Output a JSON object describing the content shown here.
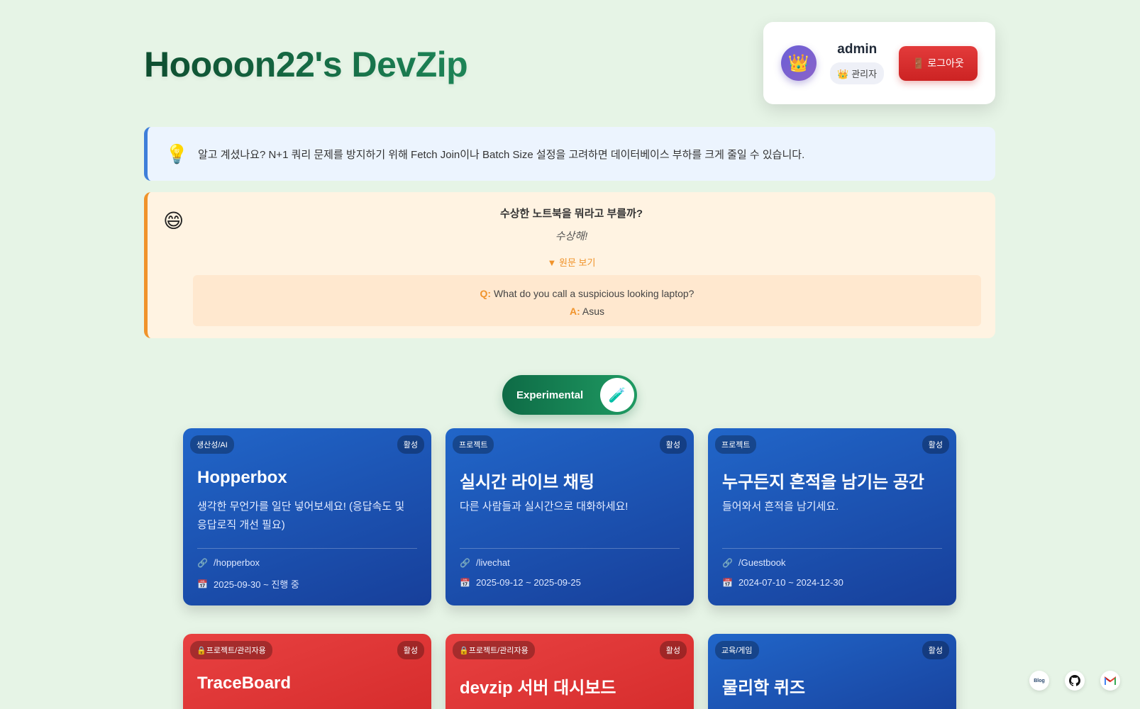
{
  "site": {
    "title": "Hoooon22's DevZip"
  },
  "user": {
    "avatar_emoji": "👑",
    "name": "admin",
    "role": "👑 관리자",
    "logout_label": "🚪 로그아웃"
  },
  "tip": {
    "icon": "💡",
    "text": "알고 계셨나요? N+1 쿼리 문제를 방지하기 위해 Fetch Join이나 Batch Size 설정을 고려하면 데이터베이스 부하를 크게 줄일 수 있습니다."
  },
  "joke": {
    "emoji": "😄",
    "question": "수상한 노트북을 뭐라고 부를까?",
    "answer": "수상해!",
    "toggle_label": "▼ 원문 보기",
    "orig_q_label": "Q:",
    "orig_question": "What do you call a suspicious looking laptop?",
    "orig_a_label": "A:",
    "orig_answer": "Asus"
  },
  "toggle": {
    "label": "Experimental",
    "icon": "🧪"
  },
  "cards": [
    {
      "category": "생산성/AI",
      "status": "활성",
      "title": "Hopperbox",
      "description": "생각한 무언가를 일단 넣어보세요! (응답속도 및 응답로직 개선 필요)",
      "path": "/hopperbox",
      "period": "2025-09-30 ~ 진행 중",
      "color": "blue"
    },
    {
      "category": "프로젝트",
      "status": "활성",
      "title": "실시간 라이브 채팅",
      "description": "다른 사람들과 실시간으로 대화하세요!",
      "path": "/livechat",
      "period": "2025-09-12 ~ 2025-09-25",
      "color": "blue"
    },
    {
      "category": "프로젝트",
      "status": "활성",
      "title": "누구든지 흔적을 남기는 공간",
      "description": "들어와서 흔적을 남기세요.",
      "path": "/Guestbook",
      "period": "2024-07-10 ~ 2024-12-30",
      "color": "blue"
    },
    {
      "category": "🔒프로젝트/관리자용",
      "status": "활성",
      "title": "TraceBoard",
      "color": "red"
    },
    {
      "category": "🔒프로젝트/관리자용",
      "status": "활성",
      "title": "devzip 서버 대시보드",
      "color": "red"
    },
    {
      "category": "교육/게임",
      "status": "활성",
      "title": "물리학 퀴즈",
      "color": "blue"
    }
  ],
  "footer": {
    "blog_label": "Blog",
    "github_icon": "github-icon",
    "gmail_icon": "gmail-icon"
  },
  "colors": {
    "accent_green": "#1f8a5b",
    "card_blue": "#2166c9",
    "card_red": "#e84141",
    "tip_border": "#3f7fd9",
    "joke_border": "#f0932b"
  }
}
